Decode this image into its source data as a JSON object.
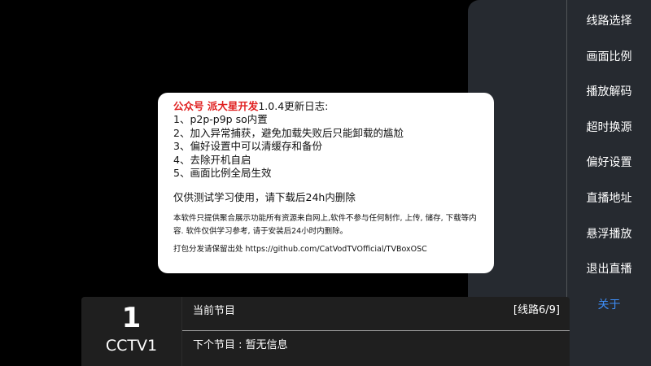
{
  "menu": {
    "items": [
      {
        "label": "线路选择"
      },
      {
        "label": "画面比例"
      },
      {
        "label": "播放解码"
      },
      {
        "label": "超时换源"
      },
      {
        "label": "偏好设置"
      },
      {
        "label": "直播地址"
      },
      {
        "label": "悬浮播放"
      },
      {
        "label": "退出直播"
      },
      {
        "label": "关于"
      }
    ],
    "active_color": "#3e8ef7"
  },
  "dialog": {
    "title_highlight": "公众号 派大星开发",
    "title_rest": "1.0.4更新日志:",
    "lines": [
      "1、p2p-p9p so内置",
      "2、加入异常捕获，避免加载失败后只能卸载的尴尬",
      "3、偏好设置中可以清缓存和备份",
      "4、去除开机自启",
      "5、画面比例全局生效"
    ],
    "notice": "仅供测试学习使用，请下载后24h内删除",
    "disclaimer": "本软件只提供聚合展示功能所有资源来自网上,软件不参与任何制作, 上传, 储存, 下载等内容. 软件仅供学习参考, 请于安装后24小时内删除。",
    "repo_line": "打包分发请保留出处  https://github.com/CatVodTVOfficial/TVBoxOSC",
    "highlight_color": "#e02020"
  },
  "info_bar": {
    "channel_number": "1",
    "channel_name": "CCTV1",
    "current_program": "当前节目",
    "next_program": "下个节目 : 暂无信息",
    "line_info": "[线路6/9]"
  }
}
